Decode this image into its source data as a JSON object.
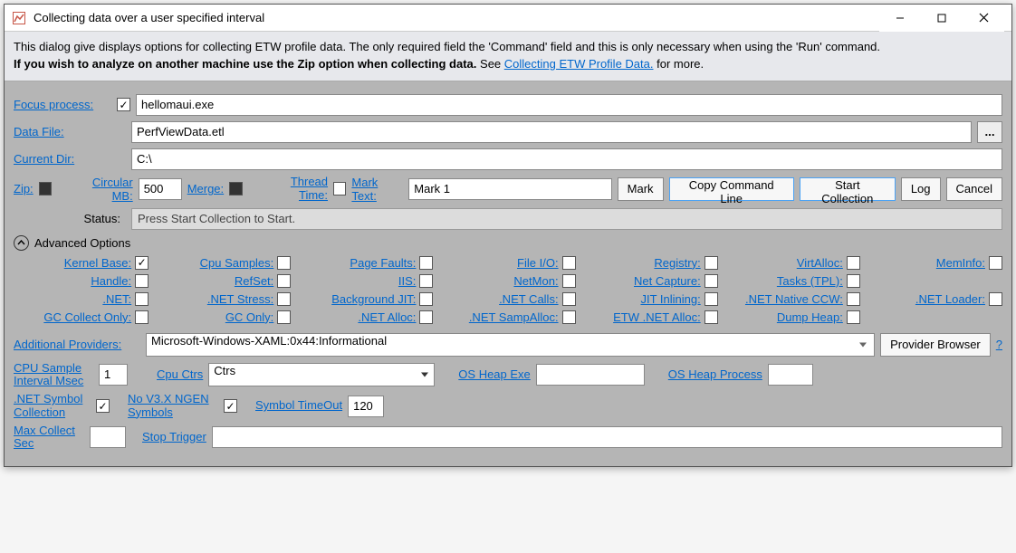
{
  "title": "Collecting data over a user specified interval",
  "info": {
    "line1": "This dialog give displays options for collecting ETW profile data. The only required field the 'Command' field and this is only necessary when using the 'Run' command.",
    "line2a": "If you wish to analyze on another machine use the Zip option when collecting data.",
    "line2b": " See ",
    "link": "Collecting ETW Profile Data.",
    "line2c": " for more."
  },
  "labels": {
    "focusProcess": "Focus process:",
    "dataFile": "Data File:",
    "currentDir": "Current Dir:",
    "zip": "Zip:",
    "circularMB": "Circular MB:",
    "merge": "Merge:",
    "threadTime": "Thread Time:",
    "markText": "Mark Text:",
    "status": "Status:",
    "advanced": "Advanced Options",
    "addProviders": "Additional Providers:",
    "cpuSample": "CPU Sample Interval Msec",
    "cpuCtrs": "Cpu Ctrs",
    "osHeapExe": "OS Heap Exe",
    "osHeapProcess": "OS Heap Process",
    "netSymbol": ".NET Symbol Collection",
    "noV3": "No V3.X NGEN Symbols",
    "symbolTimeout": "Symbol TimeOut",
    "maxCollect": "Max Collect Sec",
    "stopTrigger": "Stop Trigger"
  },
  "values": {
    "focusProcess": "hellomaui.exe",
    "dataFile": "PerfViewData.etl",
    "currentDir": "C:\\",
    "circularMB": "500",
    "markText": "Mark 1",
    "status": "Press Start Collection to Start.",
    "addProviders": "Microsoft-Windows-XAML:0x44:Informational",
    "cpuSample": "1",
    "cpuCtrs": "Ctrs",
    "symbolTimeout": "120"
  },
  "buttons": {
    "mark": "Mark",
    "copyCmd": "Copy Command Line",
    "startCollection": "Start Collection",
    "log": "Log",
    "cancel": "Cancel",
    "providerBrowser": "Provider Browser",
    "help": "?",
    "browse": "..."
  },
  "kernel": {
    "r1c1": "Kernel Base:",
    "r1c2": "Cpu Samples:",
    "r1c3": "Page Faults:",
    "r1c4": "File I/O:",
    "r1c5": "Registry:",
    "r1c6": "VirtAlloc:",
    "r1c7": "MemInfo:",
    "r2c1": "Handle:",
    "r2c2": "RefSet:",
    "r2c3": "IIS:",
    "r2c4": "NetMon:",
    "r2c5": "Net Capture:",
    "r2c6": "Tasks (TPL):",
    "r3c1": ".NET:",
    "r3c2": ".NET Stress:",
    "r3c3": "Background JIT:",
    "r3c4": ".NET Calls:",
    "r3c5": "JIT Inlining:",
    "r3c6": ".NET Native CCW:",
    "r3c7": ".NET Loader:",
    "r4c1": "GC Collect Only:",
    "r4c2": "GC Only:",
    "r4c3": ".NET Alloc:",
    "r4c4": ".NET SampAlloc:",
    "r4c5": "ETW .NET Alloc:",
    "r4c6": "Dump Heap:"
  }
}
